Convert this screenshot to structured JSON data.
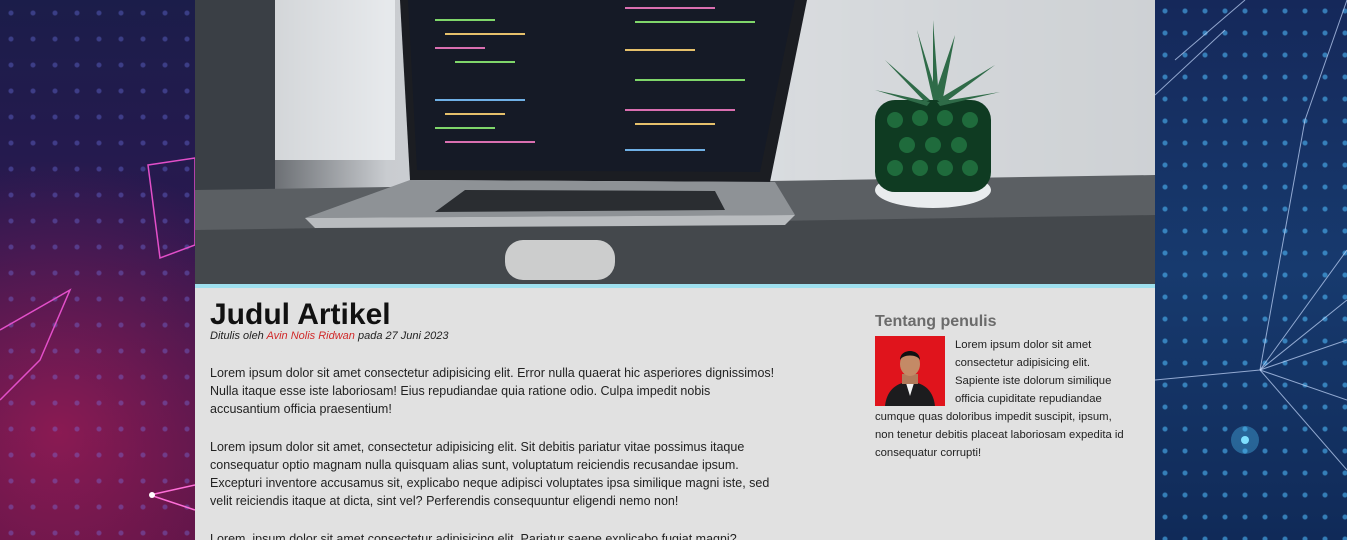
{
  "article": {
    "title": "Judul Artikel",
    "byline_prefix": "Ditulis oleh",
    "author": "Avin Nolis Ridwan",
    "byline_date": "pada 27 Juni 2023",
    "paragraphs": [
      "Lorem ipsum dolor sit amet consectetur adipisicing elit. Error nulla quaerat hic asperiores dignissimos! Nulla itaque esse iste laboriosam! Eius repudiandae quia ratione odio. Culpa impedit nobis accusantium officia praesentium!",
      "Lorem ipsum dolor sit amet, consectetur adipisicing elit. Sit debitis pariatur vitae possimus itaque consequatur optio magnam nulla quisquam alias sunt, voluptatum reiciendis recusandae ipsum. Excepturi inventore accusamus sit, explicabo neque adipisci voluptates ipsa similique magni iste, sed velit reiciendis itaque at dicta, sint vel? Perferendis consequuntur eligendi nemo non!",
      "Lorem, ipsum dolor sit amet consectetur adipisicing elit. Pariatur saepe explicabo fugiat magni?"
    ]
  },
  "aside": {
    "title": "Tentang penulis",
    "bio": "Lorem ipsum dolor sit amet consectetur adipisicing elit. Sapiente iste dolorum similique officia cupiditate repudiandae cumque quas doloribus impedit suscipit, ipsum, non tenetur debitis placeat laboriosam expedita id consequatur corrupti!"
  },
  "colors": {
    "author_link": "#d02a2a",
    "hero_underline": "#9fe0ee",
    "avatar_bg": "#e0141c",
    "content_bg": "#e1e1e1"
  },
  "icons": {
    "hero": "laptop-plant-photo",
    "avatar": "author-portrait"
  }
}
